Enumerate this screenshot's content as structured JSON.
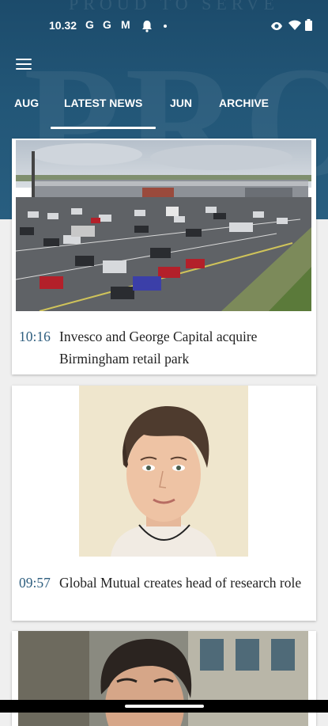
{
  "status_bar": {
    "time": "10.32",
    "notification_icons": [
      "G",
      "G",
      "M"
    ]
  },
  "header": {
    "background_tagline": "PROUD TO SERVE",
    "background_letters": "PRO"
  },
  "tabs": [
    {
      "label": "AUG",
      "selected": false
    },
    {
      "label": "LATEST NEWS",
      "selected": true
    },
    {
      "label": "JUN",
      "selected": false
    },
    {
      "label": "ARCHIVE",
      "selected": false
    }
  ],
  "articles": [
    {
      "time": "10:16",
      "headline": "Invesco and George Capital acquire Birmingham retail park"
    },
    {
      "time": "09:57",
      "headline": "Global Mutual creates head of research role"
    }
  ],
  "colors": {
    "header": "#225677",
    "time_text": "#2d5d7e",
    "background": "#efefef"
  }
}
